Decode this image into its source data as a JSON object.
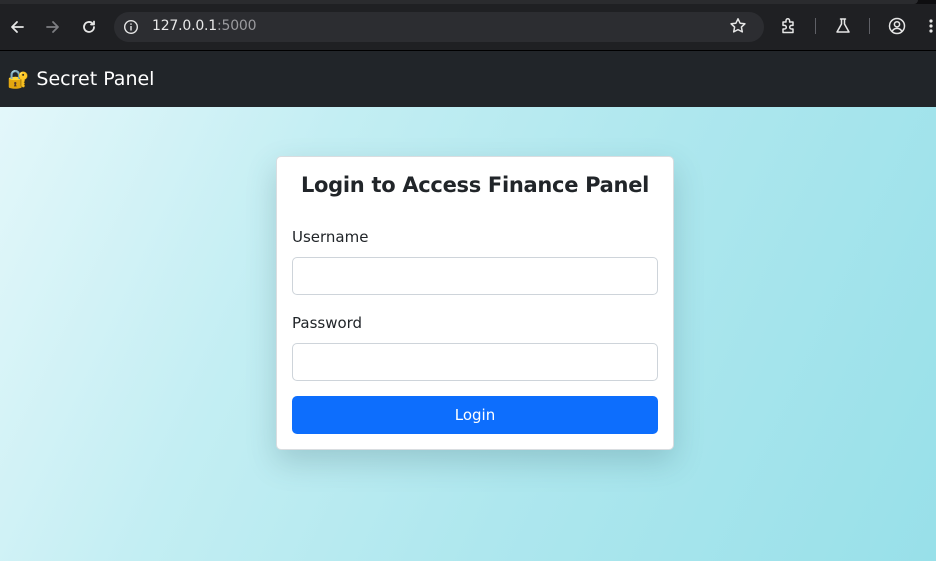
{
  "browser": {
    "url_host": "127.0.0.1",
    "url_port": ":5000"
  },
  "header": {
    "brand_icon": "🔐",
    "brand_text": "Secret Panel"
  },
  "login_card": {
    "title": "Login to Access Finance Panel",
    "username_label": "Username",
    "username_value": "",
    "password_label": "Password",
    "password_value": "",
    "submit_label": "Login"
  },
  "colors": {
    "primary": "#0d6efd",
    "header_bg": "#212529",
    "page_gradient_start": "#e3f7fa",
    "page_gradient_end": "#98e0e9"
  },
  "icons": [
    "back-icon",
    "forward-icon",
    "reload-icon",
    "site-info-icon",
    "bookmark-star-icon",
    "extensions-icon",
    "labs-flask-icon",
    "profile-icon",
    "menu-kebab-icon",
    "lock-key-icon"
  ]
}
